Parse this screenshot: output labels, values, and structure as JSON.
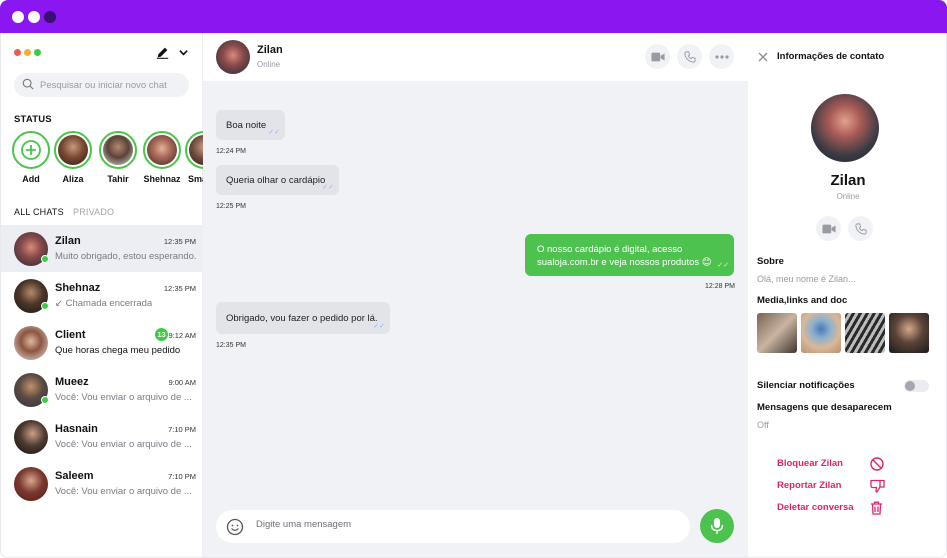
{
  "window": {
    "dots": [
      "#ffffff",
      "#ffffff",
      "#3a0e73"
    ],
    "titlebar_color": "#8b17f0"
  },
  "sidebar": {
    "menu_dots": [
      "#ef5b4b",
      "#f6b02b",
      "#3ecb46"
    ],
    "compose_icon": "pen-icon",
    "dropdown_icon": "chevron-down-icon",
    "search_placeholder": "Pesquisar ou iniciar novo chat",
    "status_title": "STATUS",
    "stories": [
      {
        "name": "Add",
        "kind": "add"
      },
      {
        "name": "Aliza",
        "color": "#5a3b2c"
      },
      {
        "name": "Tahir",
        "color": "#4e4a45"
      },
      {
        "name": "Shehnaz",
        "color": "#a86a58"
      },
      {
        "name": "Sma",
        "color": "#6d4a3a"
      }
    ],
    "tabs": {
      "all": "ALL CHATS",
      "private": "PRIVADO"
    },
    "chats": [
      {
        "name": "Zilan",
        "time": "12:35 PM",
        "preview": "Muito obrigado, estou esperando.",
        "online": true,
        "active": true
      },
      {
        "name": "Shehnaz",
        "time": "12:35 PM",
        "preview": "↙ Chamada encerrada",
        "online": true
      },
      {
        "name": "Client",
        "time": "9:12 AM",
        "preview": "Que horas chega meu pedido",
        "badge": "13",
        "unread": true
      },
      {
        "name": "Mueez",
        "time": "9:00 AM",
        "preview": "Você: Vou enviar o arquivo de ...",
        "online": true
      },
      {
        "name": "Hasnain",
        "time": "7:10 PM",
        "preview": "Você: Vou enviar o arquivo de ..."
      },
      {
        "name": "Saleem",
        "time": "7:10 PM",
        "preview": "Você: Vou enviar o arquivo de ..."
      }
    ]
  },
  "conversation": {
    "contact_name": "Zilan",
    "contact_status": "Online",
    "actions": [
      "video-icon",
      "phone-icon",
      "more-icon"
    ],
    "messages": [
      {
        "dir": "in",
        "text": "Boa noite",
        "time": "12:24 PM"
      },
      {
        "dir": "in",
        "text": "Queria olhar o cardápio",
        "time": "12:25 PM"
      },
      {
        "dir": "out",
        "line1": "O nosso cardápio é digital, acesso",
        "line2": "sualoja.com.br e veja nossos produtos 😊",
        "time": "12:28 PM"
      },
      {
        "dir": "in",
        "text": "Obrigado, vou fazer o pedido por lá.",
        "time": "12:35 PM"
      }
    ],
    "composer_placeholder": "Digite uma mensagem",
    "mic_color": "#4ec24f"
  },
  "info_panel": {
    "title": "Informações de contato",
    "name": "Zilan",
    "status": "Online",
    "about_label": "Sobre",
    "about_text": "Olá, meu nome é Zilan...",
    "media_label": "Media,links and doc",
    "mute_label": "Silenciar notificações",
    "mute_on": false,
    "disappearing_label": "Mensagens que desaparecem",
    "disappearing_value": "Off",
    "danger_color": "#e0246b",
    "block": "Bloquear Zilan",
    "report": "Reportar Zilan",
    "delete": "Deletar conversa"
  }
}
